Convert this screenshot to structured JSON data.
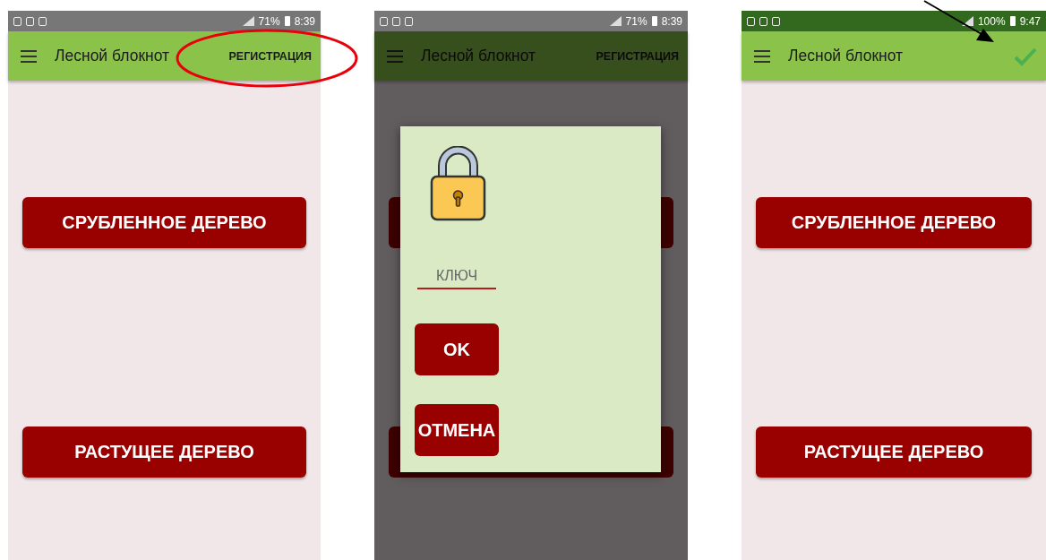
{
  "screens": [
    {
      "dimmed": false,
      "status_bar": {
        "kind": "gray",
        "battery": "71%",
        "time": "8:39"
      },
      "toolbar": {
        "title": "Лесной блокнот",
        "action": {
          "kind": "text",
          "label": "РЕГИСТРАЦИЯ"
        }
      },
      "buttons": [
        {
          "kind": "visible",
          "label": "СРУБЛЕННОЕ ДЕРЕВО"
        },
        {
          "kind": "visible",
          "label": "РАСТУЩЕЕ ДЕРЕВО"
        }
      ]
    },
    {
      "dimmed": true,
      "status_bar": {
        "kind": "gray",
        "battery": "71%",
        "time": "8:39"
      },
      "toolbar": {
        "title": "Лесной блокнот",
        "action": {
          "kind": "text",
          "label": "РЕГИСТРАЦИЯ"
        }
      },
      "buttons": [
        {
          "kind": "covered"
        },
        {
          "kind": "covered"
        }
      ],
      "dialog": {
        "field": {
          "placeholder": "КЛЮЧ"
        },
        "buttons": [
          {
            "label": "OK"
          },
          {
            "label": "ОТМЕНА"
          }
        ]
      }
    },
    {
      "dimmed": false,
      "status_bar": {
        "kind": "green",
        "battery": "100%",
        "time": "9:47"
      },
      "toolbar": {
        "title": "Лесной блокнот",
        "action": {
          "kind": "check"
        }
      },
      "buttons": [
        {
          "kind": "visible",
          "label": "СРУБЛЕННОЕ ДЕРЕВО"
        },
        {
          "kind": "visible",
          "label": "РАСТУЩЕЕ ДЕРЕВО"
        }
      ]
    }
  ],
  "annotations": [
    {
      "kind": "ellipse"
    },
    {
      "kind": "arrow"
    }
  ]
}
